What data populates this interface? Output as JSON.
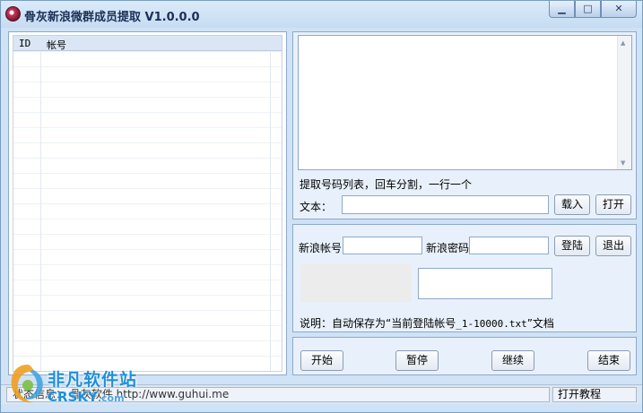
{
  "window": {
    "title": "骨灰新浪微群成员提取 V1.0.0.0",
    "controls": {
      "minimize": "▁",
      "maximize": "□",
      "close": "✕"
    }
  },
  "list": {
    "columns": [
      "ID",
      "帐号"
    ]
  },
  "import": {
    "hint": "提取号码列表，回车分割，一行一个",
    "text_label": "文本：",
    "file_value": "",
    "load_button": "载入",
    "open_button": "打开"
  },
  "login": {
    "account_label": "新浪帐号",
    "account_value": "",
    "password_label": "新浪密码",
    "password_value": "",
    "login_button": "登陆",
    "logout_button": "退出",
    "captcha_value": "",
    "note_prefix": "说明：自动保存为“当前登陆帐号",
    "note_file": "_1-10000.txt",
    "note_suffix": "”文档"
  },
  "actions": {
    "start": "开始",
    "pause": "暂停",
    "resume": "继续",
    "end": "结束"
  },
  "statusbar": {
    "status_text": "状态信息：   骨灰软件  http://www.guhui.me",
    "tutorial": "打开教程"
  },
  "watermark": {
    "name": "非凡软件站",
    "domain": "CRSKY",
    "tld": ".com"
  },
  "colors": {
    "window_bg": "#cfe2f6",
    "group_bg": "#e8f1fb",
    "watermark": "#1f8fd8"
  }
}
